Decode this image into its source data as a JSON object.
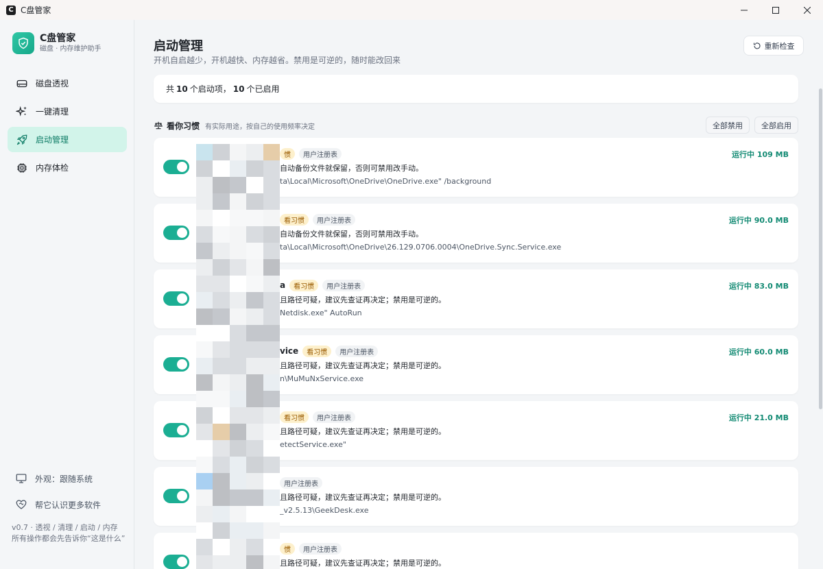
{
  "window": {
    "title": "C盘管家",
    "app_glyph": "C"
  },
  "brand": {
    "name": "C盘管家",
    "subtitle": "磁盘 · 内存维护助手"
  },
  "nav": [
    {
      "label": "磁盘透视",
      "icon": "disk-icon",
      "active": false
    },
    {
      "label": "一键清理",
      "icon": "sparkle-icon",
      "active": false
    },
    {
      "label": "启动管理",
      "icon": "rocket-icon",
      "active": true
    },
    {
      "label": "内存体检",
      "icon": "chip-icon",
      "active": false
    }
  ],
  "footer": {
    "appearance": "外观：跟随系统",
    "help": "帮它认识更多软件",
    "version": "v0.7 · 透视 / 清理 / 启动 / 内存",
    "tagline": "所有操作都会先告诉你“这是什么”"
  },
  "page": {
    "title": "启动管理",
    "subtitle": "开机自启越少，开机越快、内存越省。禁用是可逆的，随时能改回来",
    "recheck": "重新检查"
  },
  "summary": {
    "prefix": "共",
    "total": "10",
    "mid": "个启动项，",
    "enabled": "10",
    "suffix": "个已启用"
  },
  "group": {
    "title": "看你习惯",
    "desc": "有实际用途，按自己的使用频率决定",
    "disable_all": "全部禁用",
    "enable_all": "全部启用"
  },
  "items": [
    {
      "name_tail": "",
      "habit": "惯",
      "source": "用户注册表",
      "desc": "自动备份文件就保留，否则可禁用改手动。",
      "path": "ta\\Local\\Microsoft\\OneDrive\\OneDrive.exe\" /background",
      "mem": "运行中 109 MB",
      "enabled": true
    },
    {
      "name_tail": "",
      "habit": "看习惯",
      "source": "用户注册表",
      "desc": "自动备份文件就保留，否则可禁用改手动。",
      "path": "ta\\Local\\Microsoft\\OneDrive\\26.129.0706.0004\\OneDrive.Sync.Service.exe",
      "mem": "运行中 90.0 MB",
      "enabled": true
    },
    {
      "name_tail": "a",
      "habit": "看习惯",
      "source": "用户注册表",
      "desc": "且路径可疑，建议先查证再决定；禁用是可逆的。",
      "path": "Netdisk.exe\" AutoRun",
      "mem": "运行中 83.0 MB",
      "enabled": true
    },
    {
      "name_tail": "vice",
      "habit": "看习惯",
      "source": "用户注册表",
      "desc": "且路径可疑，建议先查证再决定；禁用是可逆的。",
      "path": "n\\MuMuNxService.exe",
      "mem": "运行中 60.0 MB",
      "enabled": true
    },
    {
      "name_tail": "",
      "habit": "看习惯",
      "source": "用户注册表",
      "desc": "且路径可疑，建议先查证再决定；禁用是可逆的。",
      "path": "etectService.exe\"",
      "mem": "运行中 21.0 MB",
      "enabled": true
    },
    {
      "name_tail": "",
      "habit": "",
      "source": "用户注册表",
      "desc": "且路径可疑，建议先查证再决定；禁用是可逆的。",
      "path": "_v2.5.13\\GeekDesk.exe",
      "mem": "",
      "enabled": true
    },
    {
      "name_tail": "",
      "habit": "惯",
      "source": "用户注册表",
      "desc": "且路径可疑，建议先查证再决定；禁用是可逆的。",
      "path": "",
      "mem": "",
      "enabled": true
    }
  ],
  "colors": {
    "accent": "#1bae93",
    "accent_text": "#128a73",
    "active_nav_bg": "#d2f4ea",
    "habit_tag_bg": "#fdf0cc"
  }
}
